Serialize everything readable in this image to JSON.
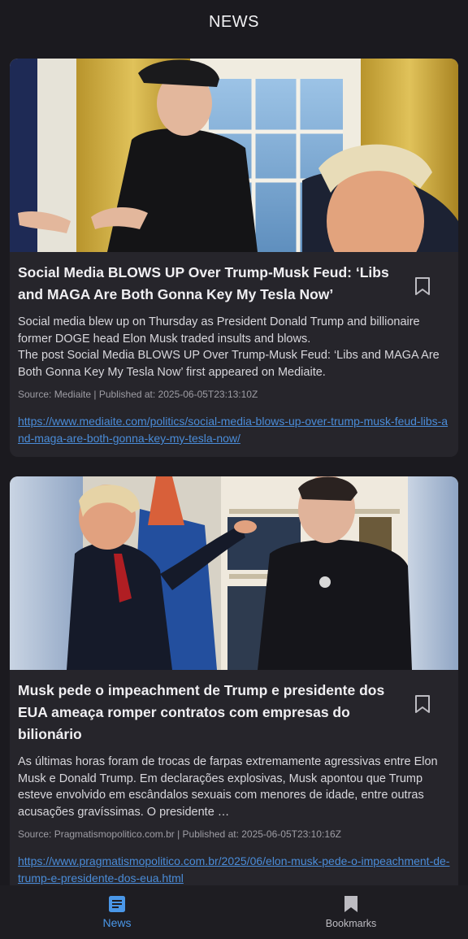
{
  "header": {
    "title": "NEWS"
  },
  "articles": [
    {
      "title": "Social Media BLOWS UP Over Trump-Musk Feud: ‘Libs and MAGA Are Both Gonna Key My Tesla Now’",
      "description_lines": [
        "Social media blew up on Thursday as President Donald Trump and billionaire former DOGE head Elon Musk traded insults and blows.",
        "The post Social Media BLOWS UP Over Trump-Musk Feud: ‘Libs and MAGA Are Both Gonna Key My Tesla Now’ first appeared on Mediaite."
      ],
      "meta": "Source: Mediaite | Published at: 2025-06-05T23:13:10Z",
      "url": "https://www.mediaite.com/politics/social-media-blows-up-over-trump-musk-feud-libs-and-maga-are-both-gonna-key-my-tesla-now/"
    },
    {
      "title": "Musk pede o impeachment de Trump e presidente dos EUA ameaça romper contratos com empresas do bilionário",
      "description_lines": [
        "As últimas horas foram de trocas de farpas extremamente agressivas entre Elon Musk e Donald Trump. Em declarações explosivas, Musk apontou que Trump esteve envolvido em escândalos sexuais com menores de idade, entre outras acusações gravíssimas. O presidente …"
      ],
      "meta": "Source: Pragmatismopolitico.com.br | Published at: 2025-06-05T23:10:16Z",
      "url": "https://www.pragmatismopolitico.com.br/2025/06/elon-musk-pede-o-impeachment-de-trump-e-presidente-dos-eua.html"
    }
  ],
  "bottom_nav": {
    "news_label": "News",
    "bookmarks_label": "Bookmarks"
  },
  "colors": {
    "background": "#1b1a1f",
    "card": "#26252b",
    "accent": "#4a97e8",
    "link": "#4a8cd8"
  },
  "icons": {
    "bookmark": "bookmark-outline-icon",
    "nav_news": "article-icon",
    "nav_bookmarks": "bookmark-filled-icon"
  }
}
